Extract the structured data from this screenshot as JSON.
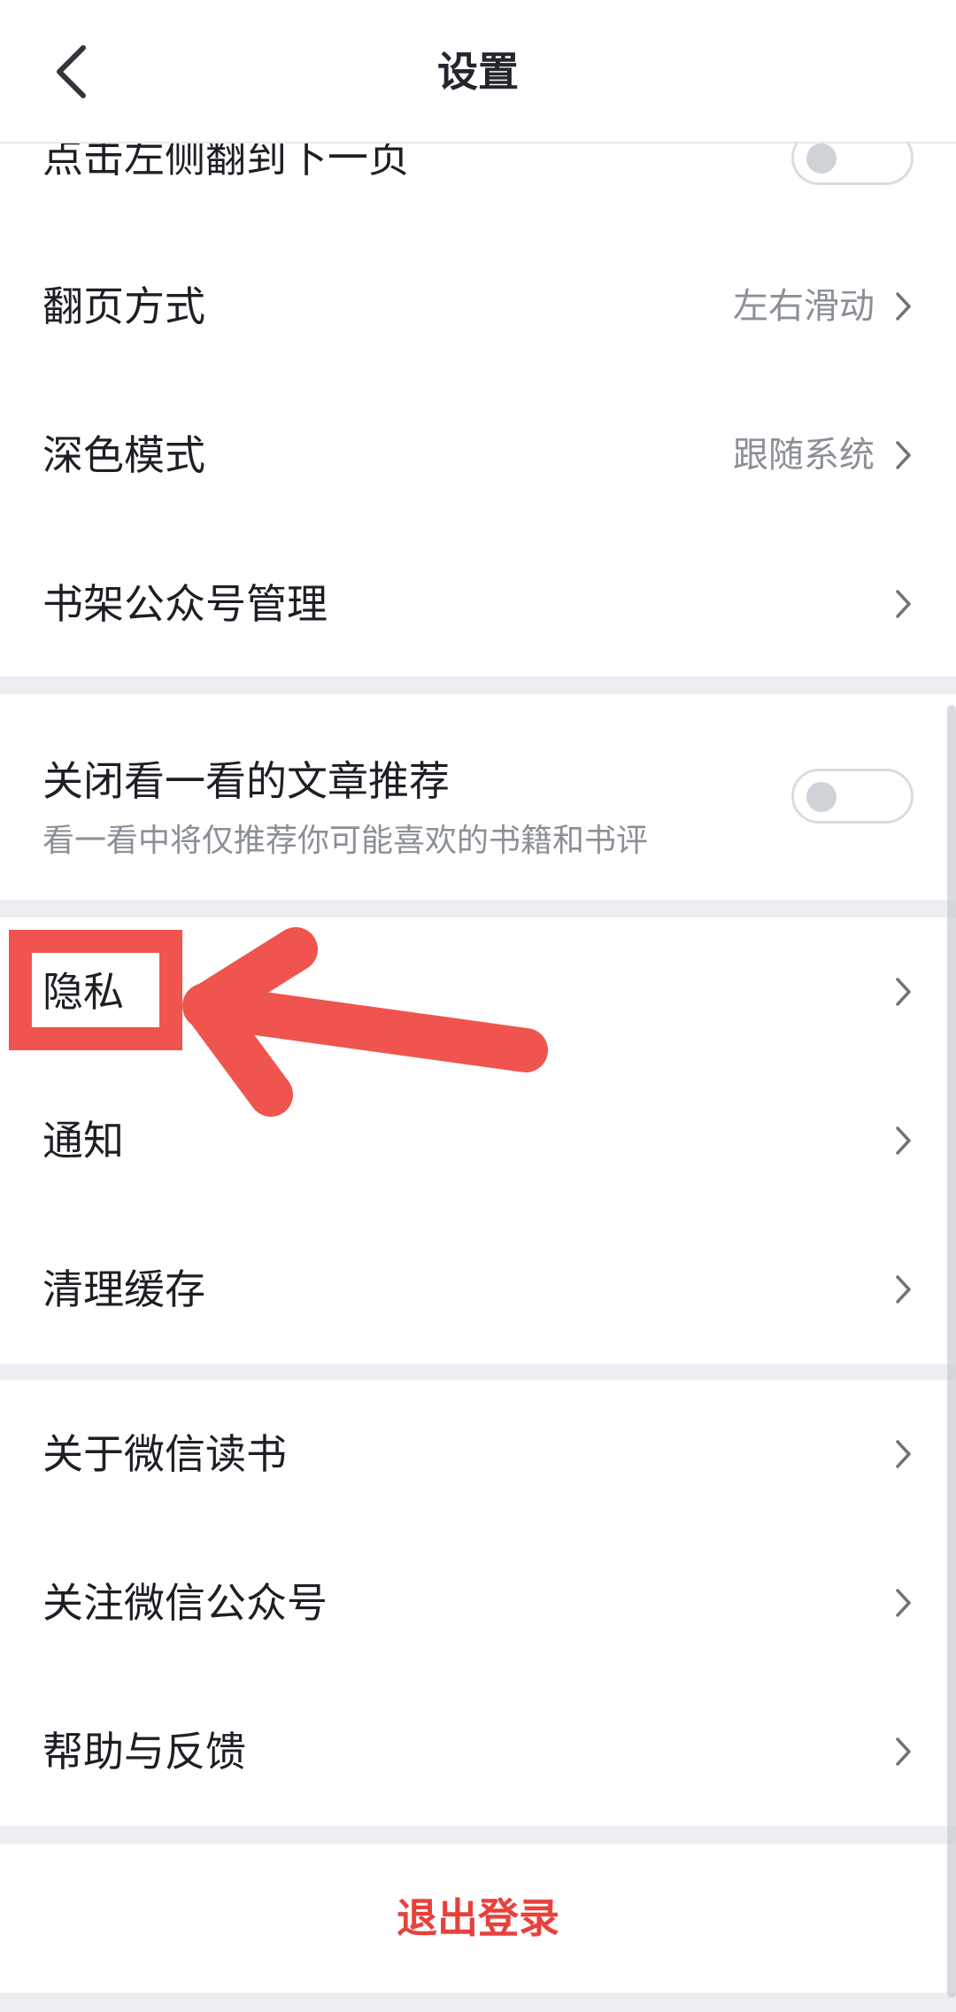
{
  "nav": {
    "title": "设置",
    "back_icon": "chevron-left-icon"
  },
  "rows_group1": [
    {
      "label": "点击左侧翻到下一页",
      "control": "toggle",
      "checked": false
    },
    {
      "label": "翻页方式",
      "value": "左右滑动",
      "control": "chevron"
    },
    {
      "label": "深色模式",
      "value": "跟随系统",
      "control": "chevron"
    },
    {
      "label": "书架公众号管理",
      "value": "",
      "control": "chevron"
    }
  ],
  "recommend": {
    "title": "关闭看一看的文章推荐",
    "description": "看一看中将仅推荐你可能喜欢的书籍和书评",
    "checked": false
  },
  "rows_group3": [
    {
      "label": "隐私"
    },
    {
      "label": "通知"
    },
    {
      "label": "清理缓存"
    }
  ],
  "rows_group4": [
    {
      "label": "关于微信读书"
    },
    {
      "label": "关注微信公众号"
    },
    {
      "label": "帮助与反馈"
    }
  ],
  "logout_label": "退出登录",
  "colors": {
    "accent_red": "#e8413c",
    "annotation_red": "#f0544f",
    "secondary_text": "#8b8f96",
    "background": "#eceef1"
  },
  "annotation": {
    "type": "arrow-and-box",
    "target": "隐私"
  }
}
